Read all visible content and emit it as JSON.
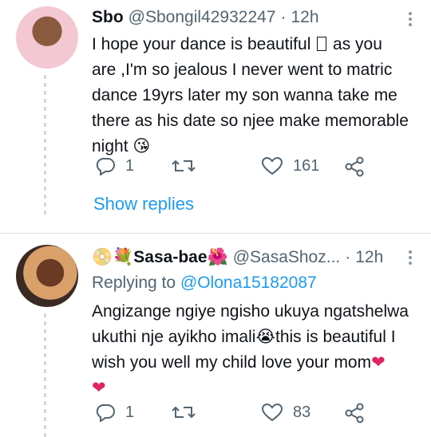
{
  "tweets": [
    {
      "name": "Sbo",
      "handle": "@Sbongil42932247",
      "separator": "·",
      "time": "12h",
      "text_1": "I hope your dance is beautiful",
      "text_2": "as you are ,I'm so jealous I never went to matric dance 19yrs later my son wanna take me there as his date so njee make memorable night",
      "emoji_end": "😘",
      "replies": "1",
      "retweets": "",
      "likes": "161",
      "show_replies": "Show replies"
    },
    {
      "name_prefix_emoji": "📀💐",
      "name": "Sasa-bae",
      "name_suffix_emoji": "🌺",
      "handle": "@SasaShoz...",
      "separator": "·",
      "time": "12h",
      "replying_label": "Replying to",
      "replying_mention": "@Olona15182087",
      "text_1": "Angizange ngiye ngisho ukuya ngatshelwa ukuthi nje ayikho imali",
      "emoji_cry": "😭",
      "text_2": "this is beautiful I wish you well my child love your mom",
      "heart_1": "❤",
      "heart_2": "❤",
      "replies": "1",
      "retweets": "",
      "likes": "83"
    }
  ],
  "icons": [
    "reply-icon",
    "retweet-icon",
    "like-icon",
    "share-icon",
    "more-icon"
  ],
  "colors": {
    "link": "#1d9bf0",
    "muted": "#536471",
    "heart": "#e0245e"
  }
}
